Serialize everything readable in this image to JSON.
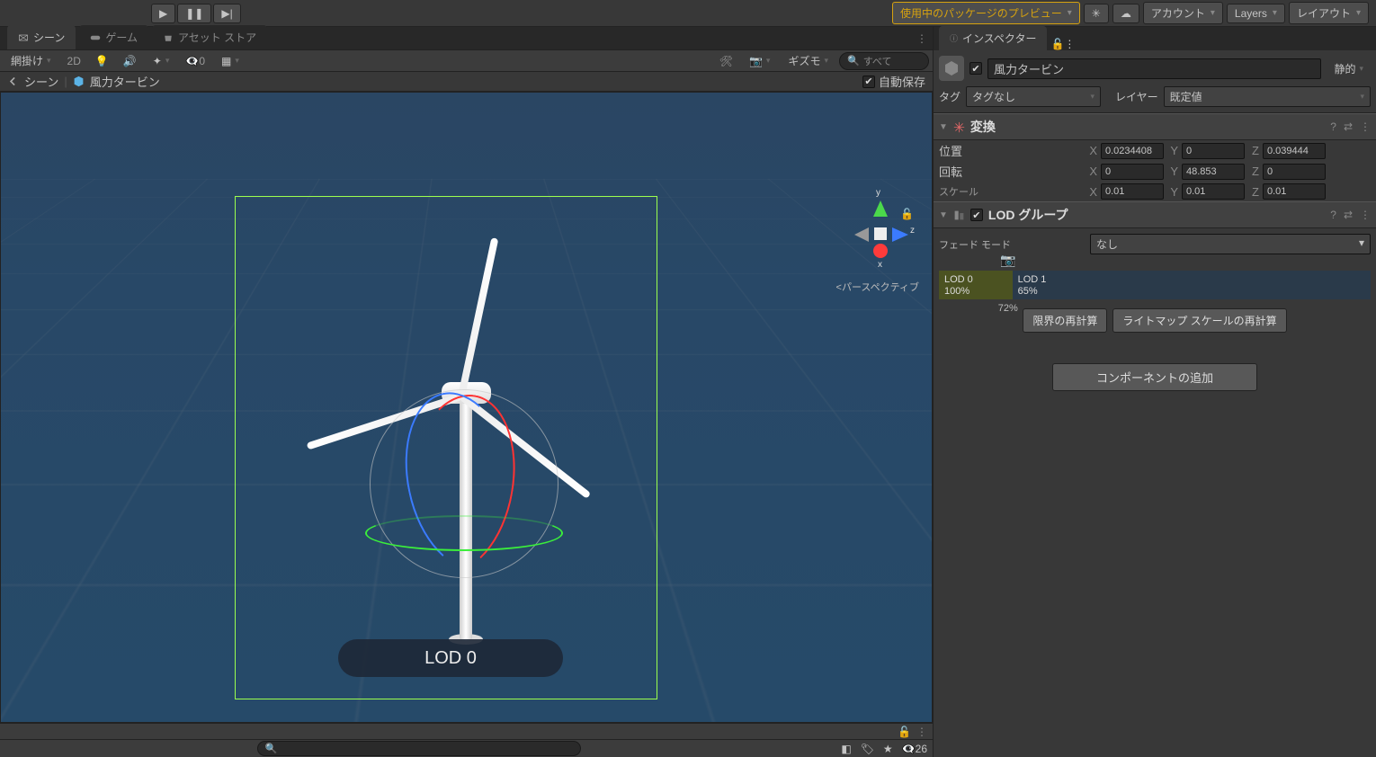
{
  "toolbar": {
    "preview_label": "使用中のパッケージのプレビュー",
    "account_label": "アカウント",
    "layers_label": "Layers",
    "layout_label": "レイアウト"
  },
  "tabs": {
    "scene": "シーン",
    "game": "ゲーム",
    "asset_store": "アセット ストア"
  },
  "scene_toolbar": {
    "shading": "網掛け",
    "twoD": "2D",
    "hidden_count": "0",
    "gizmos": "ギズモ",
    "search_placeholder": "すべて"
  },
  "breadcrumb": {
    "scene": "シーン",
    "object": "風力タービン",
    "autosave": "自動保存"
  },
  "viewport": {
    "axis_y": "y",
    "axis_x": "x",
    "axis_z": "z",
    "perspective": "<パースペクティブ",
    "lod_label": "LOD 0"
  },
  "status": {
    "hidden": "26"
  },
  "inspector": {
    "tab": "インスペクター",
    "object_name": "風力タービン",
    "static": "静的",
    "tag_label": "タグ",
    "tag_value": "タグなし",
    "layer_label": "レイヤー",
    "layer_value": "既定値",
    "transform": {
      "title": "変換",
      "position_label": "位置",
      "rotation_label": "回転",
      "scale_label": "スケール",
      "pos": {
        "x": "0.0234408",
        "y": "0",
        "z": "0.039444"
      },
      "rot": {
        "x": "0",
        "y": "48.853",
        "z": "0"
      },
      "scale": {
        "x": "0.01",
        "y": "0.01",
        "z": "0.01"
      }
    },
    "lod": {
      "title": "LOD グループ",
      "fade_label": "フェード モード",
      "fade_value": "なし",
      "lod0_name": "LOD 0",
      "lod0_pct": "100%",
      "lod1_name": "LOD 1",
      "lod1_pct": "65%",
      "cam_pct": "72%",
      "btn_bounds": "限界の再計算",
      "btn_lightmap": "ライトマップ スケールの再計算"
    },
    "add_component": "コンポーネントの追加"
  }
}
